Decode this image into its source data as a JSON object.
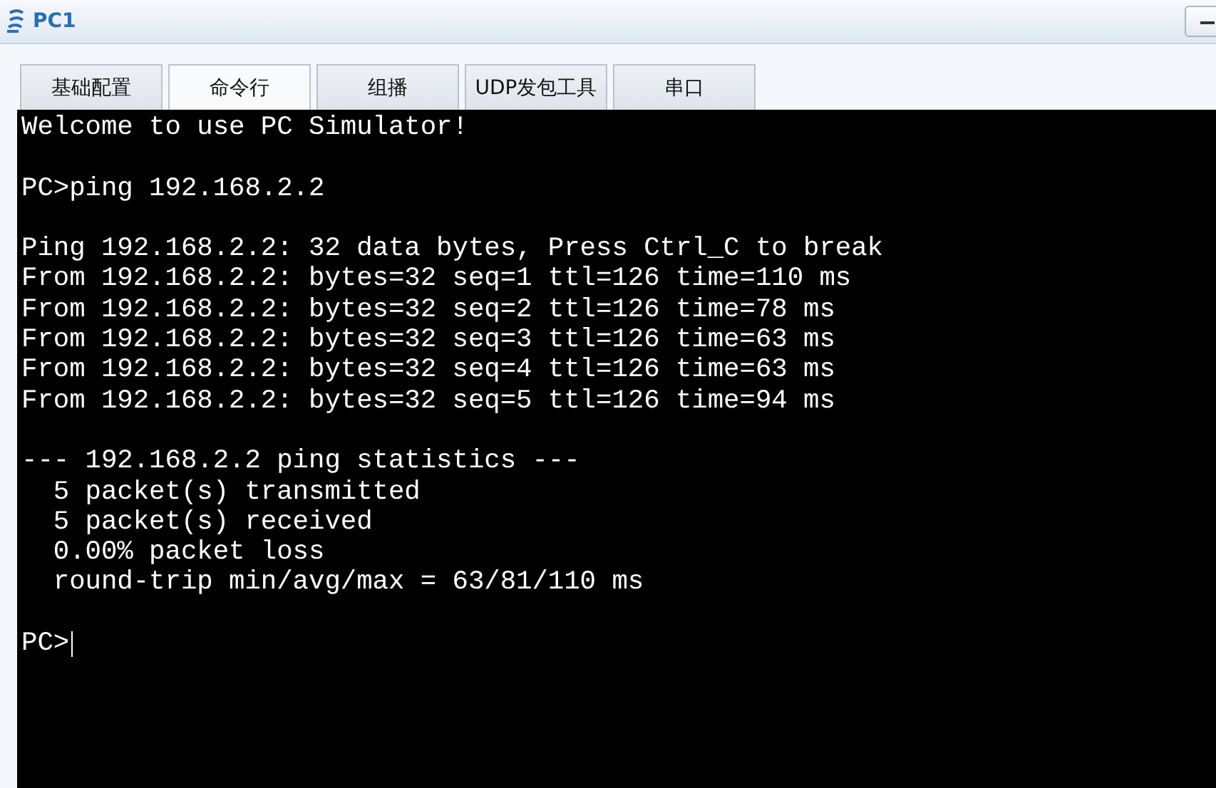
{
  "window": {
    "title": "PC1"
  },
  "tabs": [
    {
      "label": "基础配置",
      "selected": false
    },
    {
      "label": "命令行",
      "selected": true
    },
    {
      "label": "组播",
      "selected": false
    },
    {
      "label": "UDP发包工具",
      "selected": false
    },
    {
      "label": "串口",
      "selected": false
    }
  ],
  "terminal": {
    "blocks": [
      [
        "Welcome to use PC Simulator!"
      ],
      [
        "PC>ping 192.168.2.2"
      ],
      [
        "Ping 192.168.2.2: 32 data bytes, Press Ctrl_C to break",
        "From 192.168.2.2: bytes=32 seq=1 ttl=126 time=110 ms",
        "From 192.168.2.2: bytes=32 seq=2 ttl=126 time=78 ms",
        "From 192.168.2.2: bytes=32 seq=3 ttl=126 time=63 ms",
        "From 192.168.2.2: bytes=32 seq=4 ttl=126 time=63 ms",
        "From 192.168.2.2: bytes=32 seq=5 ttl=126 time=94 ms"
      ],
      [
        "--- 192.168.2.2 ping statistics ---",
        "  5 packet(s) transmitted",
        "  5 packet(s) received",
        "  0.00% packet loss",
        "  round-trip min/avg/max = 63/81/110 ms"
      ]
    ],
    "prompt": "PC>"
  }
}
